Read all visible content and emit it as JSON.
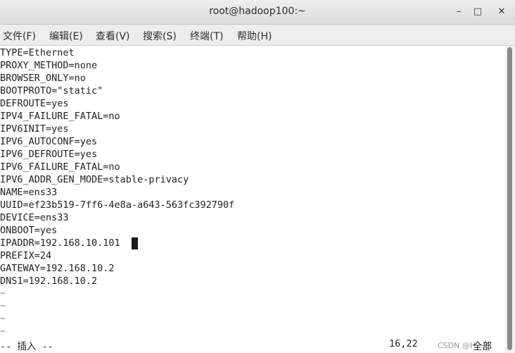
{
  "window": {
    "title": "root@hadoop100:~",
    "minimize_symbol": "–",
    "maximize_symbol": "□",
    "close_symbol": "✕"
  },
  "menu": {
    "items": [
      "文件(F)",
      "编辑(E)",
      "查看(V)",
      "搜索(S)",
      "终端(T)",
      "帮助(H)"
    ]
  },
  "editor": {
    "lines": [
      "TYPE=Ethernet",
      "PROXY_METHOD=none",
      "BROWSER_ONLY=no",
      "BOOTPROTO=\"static\"",
      "DEFROUTE=yes",
      "IPV4_FAILURE_FATAL=no",
      "IPV6INIT=yes",
      "IPV6_AUTOCONF=yes",
      "IPV6_DEFROUTE=yes",
      "IPV6_FAILURE_FATAL=no",
      "IPV6_ADDR_GEN_MODE=stable-privacy",
      "NAME=ens33",
      "UUID=ef23b519-7ff6-4e8a-a643-563fc392790f",
      "DEVICE=ens33",
      "ONBOOT=yes",
      "IPADDR=192.168.10.101",
      "PREFIX=24",
      "GATEWAY=192.168.10.2",
      "DNS1=192.168.10.2"
    ],
    "empty_line_marker": "~",
    "accent_color": "#6b7fd0"
  },
  "status": {
    "mode": "-- 插入 --",
    "position": "16,22",
    "watermark": "CSDN @H...子",
    "scroll": "全部"
  }
}
